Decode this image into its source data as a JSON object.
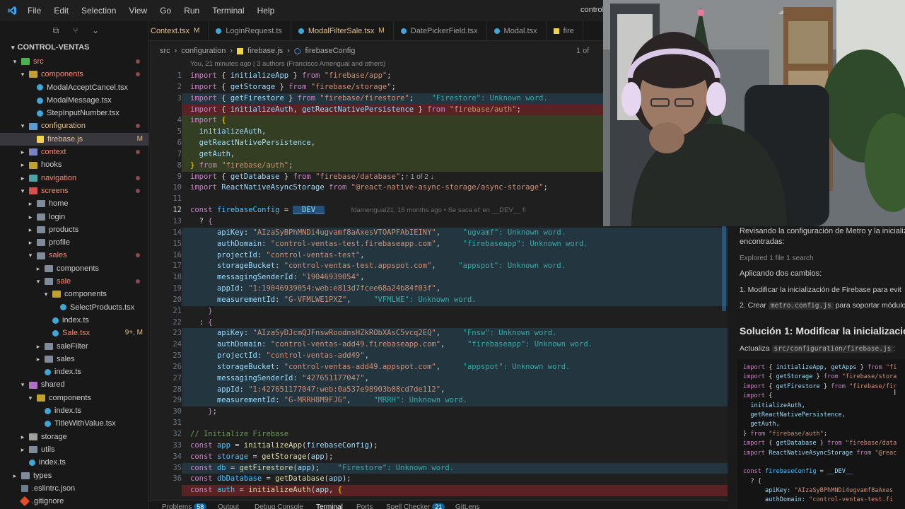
{
  "titlebar": {
    "menu": [
      "File",
      "Edit",
      "Selection",
      "View",
      "Go",
      "Run",
      "Terminal",
      "Help"
    ],
    "window_title_partial": "control"
  },
  "sidebar": {
    "root": "CONTROL-VENTAS",
    "tree": [
      {
        "name": "src",
        "kind": "folder-src",
        "depth": 1,
        "open": true,
        "dot": true,
        "cls": "c-red"
      },
      {
        "name": "components",
        "kind": "folder-comp",
        "depth": 2,
        "open": true,
        "dot": true,
        "cls": "c-red"
      },
      {
        "name": "ModalAcceptCancel.tsx",
        "kind": "file-tsx",
        "depth": 3,
        "cls": ""
      },
      {
        "name": "ModalMessage.tsx",
        "kind": "file-tsx",
        "depth": 3,
        "cls": ""
      },
      {
        "name": "StepInputNumber.tsx",
        "kind": "file-tsx",
        "depth": 3,
        "cls": ""
      },
      {
        "name": "configuration",
        "kind": "folder-conf",
        "depth": 2,
        "open": true,
        "dot": true,
        "cls": "c-yel"
      },
      {
        "name": "firebase.js",
        "kind": "file-js",
        "depth": 3,
        "badge": "M",
        "sel": true,
        "cls": "c-yel"
      },
      {
        "name": "context",
        "kind": "folder-ctx",
        "depth": 2,
        "open": false,
        "dot": true,
        "cls": "c-red"
      },
      {
        "name": "hooks",
        "kind": "folder-comp",
        "depth": 2,
        "open": false,
        "cls": ""
      },
      {
        "name": "navigation",
        "kind": "folder-nav",
        "depth": 2,
        "open": false,
        "dot": true,
        "cls": "c-red"
      },
      {
        "name": "screens",
        "kind": "folder-scr",
        "depth": 2,
        "open": true,
        "dot": true,
        "cls": "c-red"
      },
      {
        "name": "home",
        "kind": "folder",
        "depth": 3,
        "open": false,
        "cls": ""
      },
      {
        "name": "login",
        "kind": "folder",
        "depth": 3,
        "open": false,
        "cls": ""
      },
      {
        "name": "products",
        "kind": "folder",
        "depth": 3,
        "open": false,
        "cls": ""
      },
      {
        "name": "profile",
        "kind": "folder",
        "depth": 3,
        "open": false,
        "cls": ""
      },
      {
        "name": "sales",
        "kind": "folder",
        "depth": 3,
        "open": true,
        "dot": true,
        "cls": "c-red"
      },
      {
        "name": "components",
        "kind": "folder",
        "depth": 4,
        "open": false,
        "cls": ""
      },
      {
        "name": "sale",
        "kind": "folder",
        "depth": 4,
        "open": true,
        "dot": true,
        "cls": "c-red"
      },
      {
        "name": "components",
        "kind": "folder-comp",
        "depth": 5,
        "open": true,
        "cls": ""
      },
      {
        "name": "SelectProducts.tsx",
        "kind": "file-tsx",
        "depth": 6,
        "cls": ""
      },
      {
        "name": "index.ts",
        "kind": "file-tsx",
        "depth": 5,
        "cls": ""
      },
      {
        "name": "Sale.tsx",
        "kind": "file-tsx",
        "depth": 5,
        "badge": "9+, M",
        "cls": "c-red"
      },
      {
        "name": "saleFilter",
        "kind": "folder",
        "depth": 4,
        "open": false,
        "cls": ""
      },
      {
        "name": "sales",
        "kind": "folder",
        "depth": 4,
        "open": false,
        "cls": ""
      },
      {
        "name": "index.ts",
        "kind": "file-tsx",
        "depth": 4,
        "cls": ""
      },
      {
        "name": "shared",
        "kind": "folder-shared",
        "depth": 2,
        "open": true,
        "cls": ""
      },
      {
        "name": "components",
        "kind": "folder-comp",
        "depth": 3,
        "open": true,
        "cls": ""
      },
      {
        "name": "index.ts",
        "kind": "file-tsx",
        "depth": 4,
        "cls": ""
      },
      {
        "name": "TitleWithValue.tsx",
        "kind": "file-tsx",
        "depth": 4,
        "cls": ""
      },
      {
        "name": "storage",
        "kind": "folder-stor",
        "depth": 2,
        "open": false,
        "cls": ""
      },
      {
        "name": "utils",
        "kind": "folder",
        "depth": 2,
        "open": false,
        "cls": ""
      },
      {
        "name": "index.ts",
        "kind": "file-tsx",
        "depth": 2,
        "cls": ""
      },
      {
        "name": "types",
        "kind": "folder",
        "depth": 1,
        "open": false,
        "cls": ""
      },
      {
        "name": ".eslintrc.json",
        "kind": "file-json",
        "depth": 1,
        "cls": ""
      },
      {
        "name": ".gitignore",
        "kind": "file-git",
        "depth": 1,
        "cls": ""
      }
    ]
  },
  "tabs": [
    {
      "label": "Context.tsx",
      "mod": "M",
      "partial": true
    },
    {
      "label": "LoginRequest.ts",
      "mod": ""
    },
    {
      "label": "ModalFilterSale.tsx",
      "mod": "M"
    },
    {
      "label": "DatePickerField.tsx",
      "mod": ""
    },
    {
      "label": "Modal.tsx",
      "mod": ""
    },
    {
      "label": "fire",
      "mod": "",
      "partial": true
    }
  ],
  "breadcrumb": [
    "src",
    "configuration",
    "firebase.js",
    "firebaseConfig"
  ],
  "find": {
    "count": "1 of 2",
    "partial": "1 of"
  },
  "blame_header": "You, 21 minutes ago | 3 authors (Francisco Amengual and others)",
  "current_line_blame": "fdamengual21, 16 months ago • Se saca el' en __DEV__ fi",
  "spell_note": "Unknown word.",
  "panel": {
    "tabs": [
      "Problems",
      "Output",
      "Debug Console",
      "Terminal",
      "Ports",
      "Spell Checker",
      "GitLens"
    ],
    "problems_count": "58",
    "spell_count": "21"
  },
  "chat": {
    "intro": "Revisando la configuración de Metro y la inicializ",
    "intro2": "encontradas:",
    "explored": "Explored 1 file 1 search",
    "applying": "Aplicando dos cambios:",
    "step1": "1. Modificar la inicialización de Firebase para evit",
    "step2_pre": "2. Crear",
    "step2_code": "metro.config.js",
    "step2_post": "para soportar módulo",
    "heading": "Solución 1: Modificar la inicialización",
    "actualiza": "Actualiza",
    "actualiza_code": "src/configuration/firebase.js",
    "actualiza_post": ":"
  },
  "colors": {
    "accent": "#0e639c",
    "added": "#5a7828",
    "deleted": "#c82828",
    "modified": "#e2c08d"
  }
}
